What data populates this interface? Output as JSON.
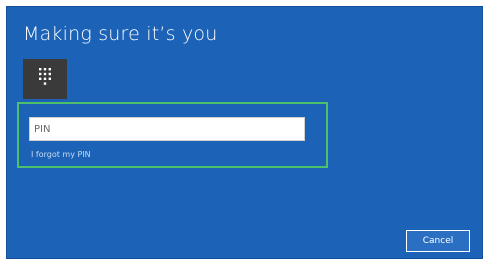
{
  "dialog": {
    "title": "Making sure it’s you",
    "background_color": "#1c62b6",
    "highlight_color": "#4cc06a",
    "pin_tile_icon": "keypad-icon",
    "pin_input": {
      "placeholder": "PIN",
      "value": ""
    },
    "forgot_pin_label": "I forgot my PIN",
    "cancel_label": "Cancel"
  }
}
